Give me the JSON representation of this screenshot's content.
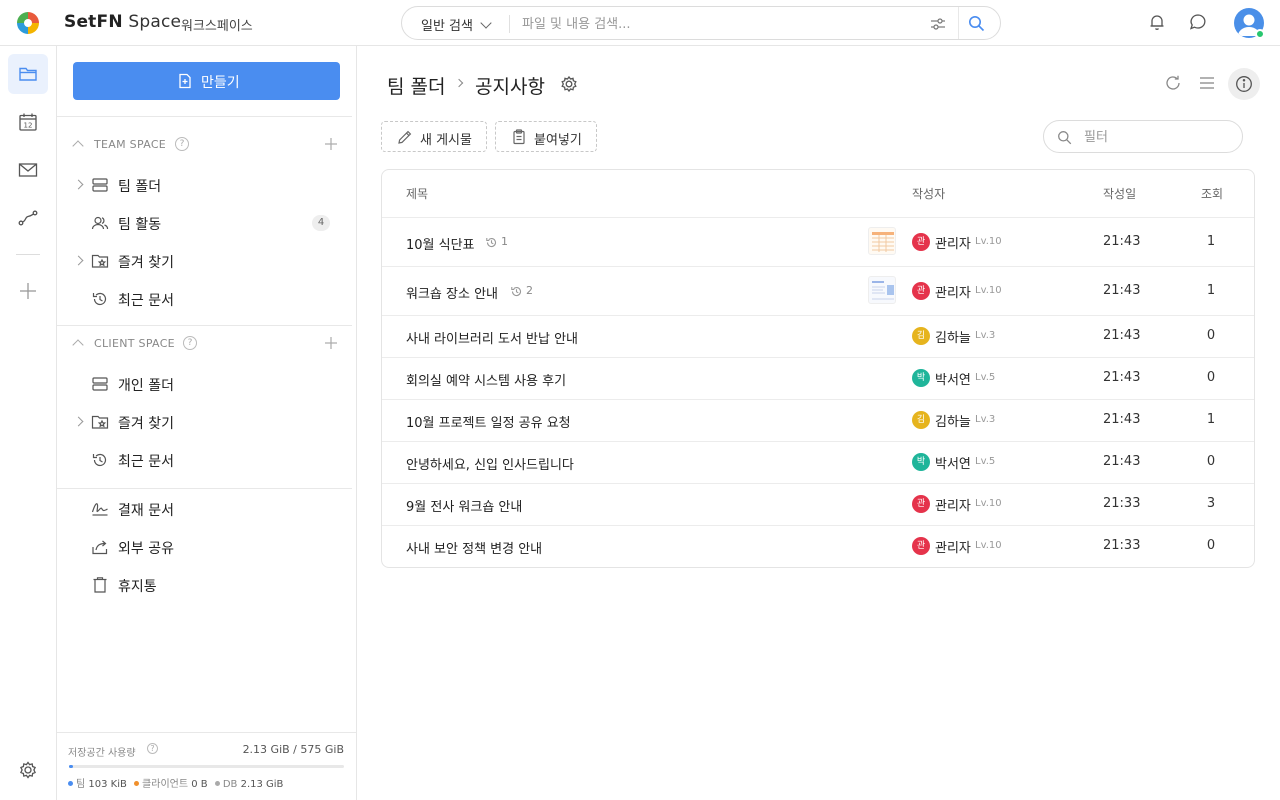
{
  "header": {
    "brand_bold": "SetFN",
    "brand_light": "Space",
    "workspace": "워크스페이스",
    "search_mode": "일반 검색",
    "search_placeholder": "파일 및 내용 검색..."
  },
  "sidebar": {
    "create_label": "만들기",
    "team_space": {
      "title": "TEAM SPACE",
      "items": [
        {
          "label": "팀 폴더",
          "icon": "server-icon",
          "expandable": true
        },
        {
          "label": "팀 활동",
          "icon": "users-icon",
          "badge": "4"
        },
        {
          "label": "즐겨 찾기",
          "icon": "star-folder-icon",
          "expandable": true
        },
        {
          "label": "최근 문서",
          "icon": "history-icon"
        }
      ]
    },
    "client_space": {
      "title": "CLIENT SPACE",
      "items": [
        {
          "label": "개인 폴더",
          "icon": "server-icon"
        },
        {
          "label": "즐겨 찾기",
          "icon": "star-folder-icon",
          "expandable": true
        },
        {
          "label": "최근 문서",
          "icon": "history-icon"
        }
      ]
    },
    "extra_items": [
      {
        "label": "결재 문서",
        "icon": "signature-icon"
      },
      {
        "label": "외부 공유",
        "icon": "share-icon"
      },
      {
        "label": "휴지통",
        "icon": "trash-icon"
      }
    ],
    "storage": {
      "label": "저장공간 사용량",
      "value": "2.13 GiB / 575 GiB",
      "used_fraction": 0.004,
      "legend": [
        {
          "label": "팀",
          "value": "103 KiB",
          "color": "#4a8df0"
        },
        {
          "label": "클라이언트",
          "value": "0 B",
          "color": "#f0902c"
        },
        {
          "label": "DB",
          "value": "2.13 GiB",
          "color": "#aaaaaa"
        }
      ]
    }
  },
  "main": {
    "breadcrumb_parent": "팀 폴더",
    "breadcrumb_current": "공지사항",
    "new_post_label": "새 게시물",
    "paste_label": "붙여넣기",
    "filter_placeholder": "필터",
    "columns": {
      "title": "제목",
      "author": "작성자",
      "date": "작성일",
      "views": "조회"
    },
    "rows": [
      {
        "title": "10월 식단표",
        "revisions": "1",
        "thumb": "table",
        "author": "관리자",
        "initial": "관",
        "color": "#e5334b",
        "level": "Lv.10",
        "date": "21:43",
        "views": "1"
      },
      {
        "title": "워크숍 장소 안내",
        "revisions": "2",
        "thumb": "doc",
        "author": "관리자",
        "initial": "관",
        "color": "#e5334b",
        "level": "Lv.10",
        "date": "21:43",
        "views": "1"
      },
      {
        "title": "사내 라이브러리 도서 반납 안내",
        "author": "김하늘",
        "initial": "김",
        "color": "#e6b41e",
        "level": "Lv.3",
        "date": "21:43",
        "views": "0"
      },
      {
        "title": "회의실 예약 시스템 사용 후기",
        "author": "박서연",
        "initial": "박",
        "color": "#1fb59a",
        "level": "Lv.5",
        "date": "21:43",
        "views": "0"
      },
      {
        "title": "10월 프로젝트 일정 공유 요청",
        "author": "김하늘",
        "initial": "김",
        "color": "#e6b41e",
        "level": "Lv.3",
        "date": "21:43",
        "views": "1"
      },
      {
        "title": "안녕하세요, 신입 인사드립니다",
        "author": "박서연",
        "initial": "박",
        "color": "#1fb59a",
        "level": "Lv.5",
        "date": "21:43",
        "views": "0"
      },
      {
        "title": "9월 전사 워크숍 안내",
        "author": "관리자",
        "initial": "관",
        "color": "#e5334b",
        "level": "Lv.10",
        "date": "21:33",
        "views": "3"
      },
      {
        "title": "사내 보안 정책 변경 안내",
        "author": "관리자",
        "initial": "관",
        "color": "#e5334b",
        "level": "Lv.10",
        "date": "21:33",
        "views": "0"
      }
    ]
  }
}
